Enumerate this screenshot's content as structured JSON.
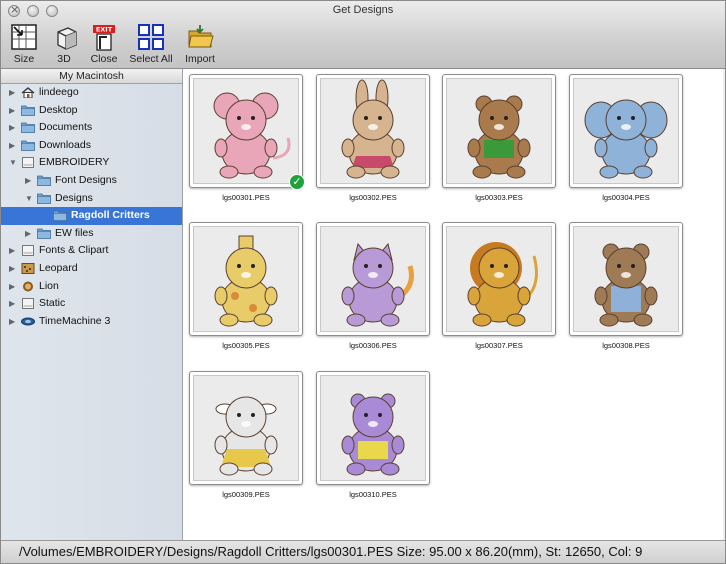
{
  "window": {
    "title": "Get Designs"
  },
  "toolbar": {
    "items": [
      {
        "label": "Size",
        "icon": "size-grid-icon"
      },
      {
        "label": "3D",
        "icon": "cube-3d-icon"
      },
      {
        "label": "Close",
        "icon": "exit-door-icon"
      },
      {
        "label": "Select All",
        "icon": "select-all-grid-icon"
      },
      {
        "label": "Import",
        "icon": "folder-import-icon"
      }
    ]
  },
  "sidebar": {
    "header": "My Macintosh",
    "items": [
      {
        "label": "lindeego",
        "icon": "home-icon",
        "expanded": false,
        "level": 0
      },
      {
        "label": "Desktop",
        "icon": "folder-icon",
        "expanded": false,
        "level": 0
      },
      {
        "label": "Documents",
        "icon": "folder-icon",
        "expanded": false,
        "level": 0
      },
      {
        "label": "Downloads",
        "icon": "folder-icon",
        "expanded": false,
        "level": 0
      },
      {
        "label": "EMBROIDERY",
        "icon": "drive-icon",
        "expanded": true,
        "level": 0
      },
      {
        "label": "Font Designs",
        "icon": "folder-icon",
        "expanded": false,
        "level": 1
      },
      {
        "label": "Designs",
        "icon": "folder-icon",
        "expanded": true,
        "level": 1
      },
      {
        "label": "Ragdoll Critters",
        "icon": "folder-icon",
        "expanded": false,
        "level": 2,
        "selected": true
      },
      {
        "label": "EW files",
        "icon": "folder-icon",
        "expanded": false,
        "level": 1
      },
      {
        "label": "Fonts & Clipart",
        "icon": "drive-icon",
        "expanded": false,
        "level": 0
      },
      {
        "label": "Leopard",
        "icon": "leopard-icon",
        "expanded": false,
        "level": 0
      },
      {
        "label": "Lion",
        "icon": "lion-icon",
        "expanded": false,
        "level": 0
      },
      {
        "label": "Static",
        "icon": "drive-icon",
        "expanded": false,
        "level": 0
      },
      {
        "label": "TimeMachine 3",
        "icon": "timemachine-icon",
        "expanded": false,
        "level": 0
      }
    ]
  },
  "designs": [
    {
      "file": "lgs00301.PES",
      "subject": "mouse",
      "color": "#e8a6b8",
      "selected": true
    },
    {
      "file": "lgs00302.PES",
      "subject": "bunny",
      "color": "#d6b48f"
    },
    {
      "file": "lgs00303.PES",
      "subject": "bear",
      "color": "#a87a4c"
    },
    {
      "file": "lgs00304.PES",
      "subject": "elephant",
      "color": "#8fb2d8"
    },
    {
      "file": "lgs00305.PES",
      "subject": "giraffe",
      "color": "#e8cc6a"
    },
    {
      "file": "lgs00306.PES",
      "subject": "cat",
      "color": "#b79ad6"
    },
    {
      "file": "lgs00307.PES",
      "subject": "lion",
      "color": "#d9a53b"
    },
    {
      "file": "lgs00308.PES",
      "subject": "monkey",
      "color": "#9e7a55"
    },
    {
      "file": "lgs00309.PES",
      "subject": "cow",
      "color": "#e6e6e6"
    },
    {
      "file": "lgs00310.PES",
      "subject": "hippo",
      "color": "#a98ad6"
    }
  ],
  "status": {
    "text": "/Volumes/EMBROIDERY/Designs/Ragdoll Critters/lgs00301.PES Size: 95.00 x 86.20(mm), St: 12650, Col: 9"
  }
}
